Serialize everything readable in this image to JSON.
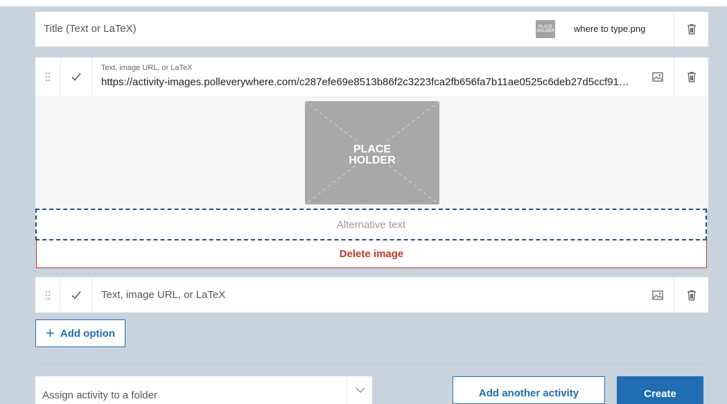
{
  "title_field": {
    "placeholder": "Title (Text or LaTeX)",
    "thumbnail_text": "PLACE HOLDER",
    "filename": "where to type.png"
  },
  "option1": {
    "label": "Text, image URL, or LaTeX",
    "value": "https://activity-images.polleverywhere.com/c287efe69e8513b86f2c3223fca2fb656fa7b11ae0525c6deb27d5ccf91…"
  },
  "image_panel": {
    "placeholder_line1": "PLACE",
    "placeholder_line2": "HOLDER",
    "alt_text_placeholder": "Alternative text",
    "delete_label": "Delete image"
  },
  "option2": {
    "placeholder": "Text, image URL, or LaTeX"
  },
  "add_option_label": "Add option",
  "footer": {
    "folder_placeholder": "Assign activity to a folder",
    "add_another_label": "Add another activity",
    "create_label": "Create"
  },
  "colors": {
    "accent": "#1f6db2",
    "danger": "#c0392b",
    "background": "#c9d3dd"
  },
  "icons": [
    "trash-icon",
    "drag-handle-icon",
    "checkmark-icon",
    "image-icon",
    "plus-icon",
    "chevron-down-icon"
  ]
}
